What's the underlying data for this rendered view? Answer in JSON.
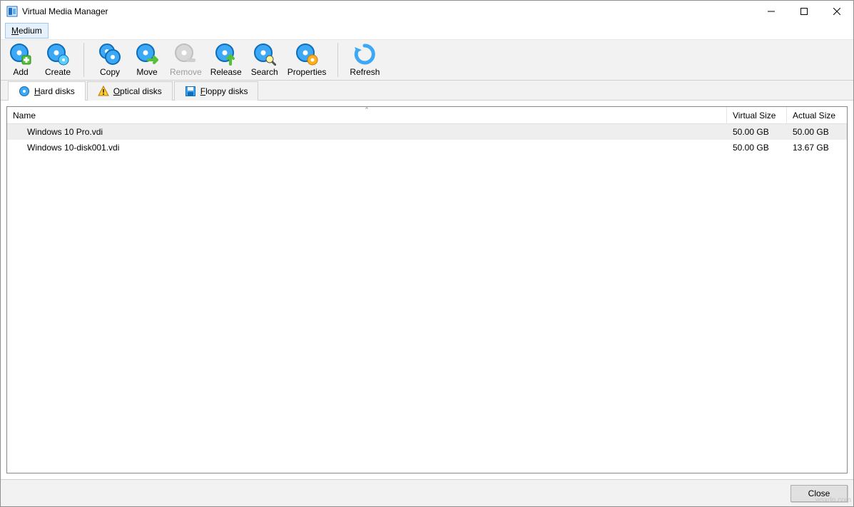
{
  "window": {
    "title": "Virtual Media Manager"
  },
  "menu": {
    "medium": "Medium"
  },
  "toolbar": {
    "add": "Add",
    "create": "Create",
    "copy": "Copy",
    "move": "Move",
    "remove": "Remove",
    "release": "Release",
    "search": "Search",
    "properties": "Properties",
    "refresh": "Refresh"
  },
  "tabs": {
    "hard_disks": "Hard disks",
    "optical_disks": "Optical disks",
    "floppy_disks": "Floppy disks"
  },
  "columns": {
    "name": "Name",
    "virtual_size": "Virtual Size",
    "actual_size": "Actual Size"
  },
  "rows": [
    {
      "name": "Windows 10 Pro.vdi",
      "virtual_size": "50.00 GB",
      "actual_size": "50.00 GB",
      "selected": true
    },
    {
      "name": "Windows 10-disk001.vdi",
      "virtual_size": "50.00 GB",
      "actual_size": "13.67 GB",
      "selected": false
    }
  ],
  "buttons": {
    "close": "Close"
  },
  "watermark": "wsxdn.com"
}
